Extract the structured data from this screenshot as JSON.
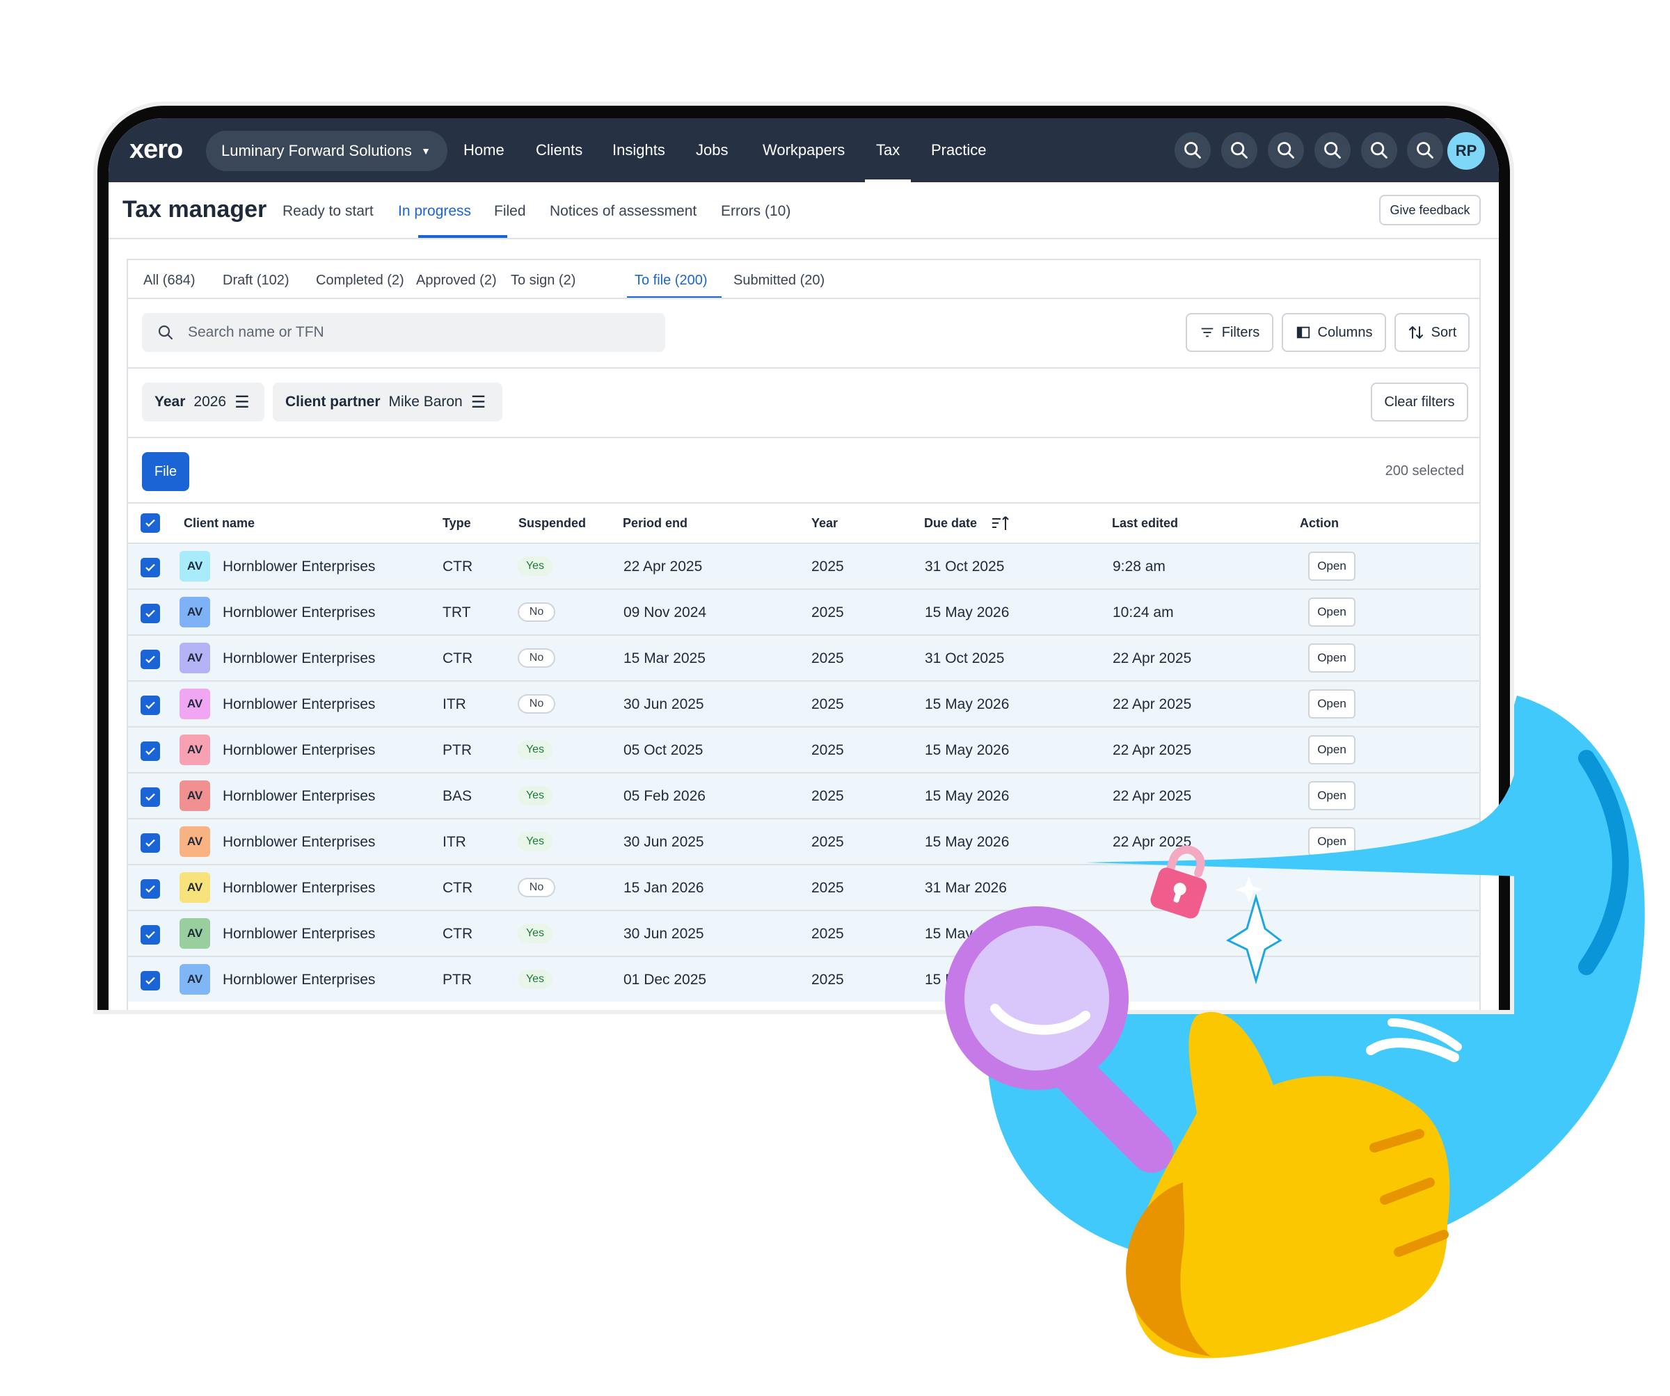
{
  "nav": {
    "logo": "xero",
    "org": "Luminary Forward Solutions",
    "links": [
      "Home",
      "Clients",
      "Insights",
      "Jobs",
      "Workpapers",
      "Tax",
      "Practice"
    ],
    "active": "Tax",
    "user_initials": "RP"
  },
  "header": {
    "title": "Tax manager",
    "tabs": [
      "Ready to start",
      "In progress",
      "Filed",
      "Notices of assessment",
      "Errors (10)"
    ],
    "active_tab": "In progress",
    "feedback_label": "Give feedback"
  },
  "status_tabs": [
    "All (684)",
    "Draft (102)",
    "Completed (2)",
    "Approved (2)",
    "To sign (2)",
    "To file (200)",
    "Submitted (20)"
  ],
  "active_status_tab": "To file (200)",
  "search": {
    "placeholder": "Search name or TFN"
  },
  "toolbar": {
    "filters": "Filters",
    "columns": "Columns",
    "sort": "Sort"
  },
  "filters": {
    "year_label": "Year",
    "year_value": "2026",
    "partner_label": "Client partner",
    "partner_value": "Mike Baron",
    "clear_label": "Clear filters"
  },
  "actions": {
    "file_label": "File",
    "selected_count": "200 selected"
  },
  "table": {
    "columns": [
      "Client name",
      "Type",
      "Suspended",
      "Period end",
      "Year",
      "Due date",
      "Last edited",
      "Action"
    ],
    "rows": [
      {
        "initials": "AV",
        "avatar_color": "#a8ecfb",
        "client": "Hornblower Enterprises",
        "type": "CTR",
        "suspended": "Yes",
        "period_end": "22 Apr 2025",
        "year": "2025",
        "due_date": "31 Oct 2025",
        "last_edited": "9:28 am",
        "action": "Open"
      },
      {
        "initials": "AV",
        "avatar_color": "#7fb1f7",
        "client": "Hornblower Enterprises",
        "type": "TRT",
        "suspended": "No",
        "period_end": "09 Nov 2024",
        "year": "2025",
        "due_date": "15 May 2026",
        "last_edited": "10:24 am",
        "action": "Open"
      },
      {
        "initials": "AV",
        "avatar_color": "#b3b3f5",
        "client": "Hornblower Enterprises",
        "type": "CTR",
        "suspended": "No",
        "period_end": "15 Mar 2025",
        "year": "2025",
        "due_date": "31 Oct 2025",
        "last_edited": "22 Apr 2025",
        "action": "Open"
      },
      {
        "initials": "AV",
        "avatar_color": "#f0a6f3",
        "client": "Hornblower Enterprises",
        "type": "ITR",
        "suspended": "No",
        "period_end": "30 Jun 2025",
        "year": "2025",
        "due_date": "15 May 2026",
        "last_edited": "22 Apr 2025",
        "action": "Open"
      },
      {
        "initials": "AV",
        "avatar_color": "#f8a1b3",
        "client": "Hornblower Enterprises",
        "type": "PTR",
        "suspended": "Yes",
        "period_end": "05 Oct 2025",
        "year": "2025",
        "due_date": "15 May 2026",
        "last_edited": "22 Apr 2025",
        "action": "Open"
      },
      {
        "initials": "AV",
        "avatar_color": "#f09090",
        "client": "Hornblower Enterprises",
        "type": "BAS",
        "suspended": "Yes",
        "period_end": "05 Feb 2026",
        "year": "2025",
        "due_date": "15 May 2026",
        "last_edited": "22 Apr 2025",
        "action": "Open"
      },
      {
        "initials": "AV",
        "avatar_color": "#f9b382",
        "client": "Hornblower Enterprises",
        "type": "ITR",
        "suspended": "Yes",
        "period_end": "30 Jun 2025",
        "year": "2025",
        "due_date": "15 May 2026",
        "last_edited": "22 Apr 2025",
        "action": "Open"
      },
      {
        "initials": "AV",
        "avatar_color": "#f7e27c",
        "client": "Hornblower Enterprises",
        "type": "CTR",
        "suspended": "No",
        "period_end": "15 Jan 2026",
        "year": "2025",
        "due_date": "31 Mar 2026",
        "last_edited": "",
        "action": ""
      },
      {
        "initials": "AV",
        "avatar_color": "#99cf9f",
        "client": "Hornblower Enterprises",
        "type": "CTR",
        "suspended": "Yes",
        "period_end": "30 Jun 2025",
        "year": "2025",
        "due_date": "15 May 2026",
        "last_edited": "",
        "action": ""
      },
      {
        "initials": "AV",
        "avatar_color": "#80b6f5",
        "client": "Hornblower Enterprises",
        "type": "PTR",
        "suspended": "Yes",
        "period_end": "01 Dec 2025",
        "year": "2025",
        "due_date": "15 May 2026",
        "last_edited": "",
        "action": ""
      }
    ]
  },
  "colors": {
    "nav_bg": "#263244",
    "accent": "#1b64d6",
    "row_bg": "#eef6fc",
    "blob": "#41c9fb"
  }
}
